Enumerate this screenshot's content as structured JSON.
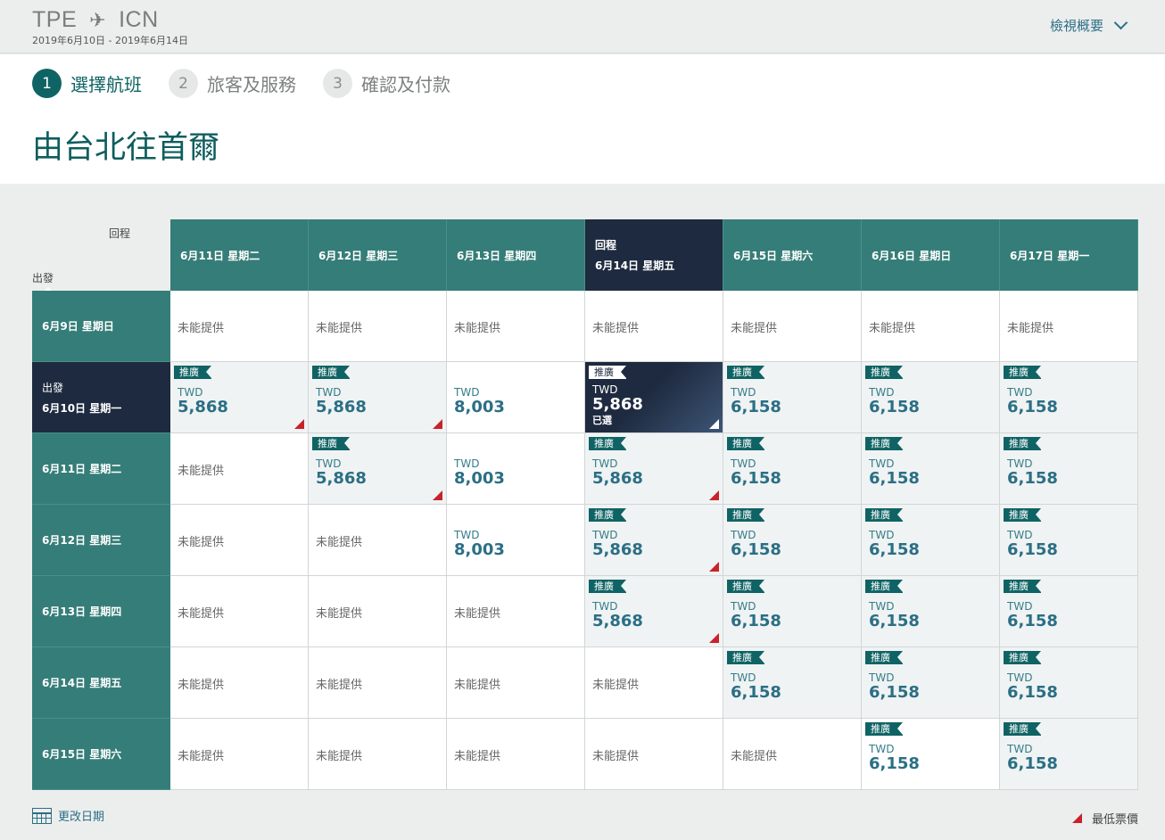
{
  "header": {
    "origin": "TPE",
    "destination": "ICN",
    "dates": "2019年6月10日 - 2019年6月14日",
    "view_summary": "檢視概要"
  },
  "steps": [
    {
      "num": "1",
      "label": "選擇航班",
      "active": true
    },
    {
      "num": "2",
      "label": "旅客及服務",
      "active": false
    },
    {
      "num": "3",
      "label": "確認及付款",
      "active": false
    }
  ],
  "title": "由台北往首爾",
  "grid": {
    "return_label": "回程",
    "depart_label": "出發",
    "columns": [
      {
        "label": "6月11日 星期二",
        "selected": false
      },
      {
        "label": "6月12日 星期三",
        "selected": false
      },
      {
        "label": "6月13日 星期四",
        "selected": false
      },
      {
        "label": "6月14日 星期五",
        "selected": true,
        "tag": "回程"
      },
      {
        "label": "6月15日 星期六",
        "selected": false
      },
      {
        "label": "6月16日 星期日",
        "selected": false
      },
      {
        "label": "6月17日 星期一",
        "selected": false
      }
    ],
    "rows": [
      {
        "label": "6月9日 星期日",
        "selected": false,
        "cells": [
          {
            "na": true
          },
          {
            "na": true
          },
          {
            "na": true
          },
          {
            "na": true
          },
          {
            "na": true
          },
          {
            "na": true
          },
          {
            "na": true
          }
        ]
      },
      {
        "label": "6月10日 星期一",
        "selected": true,
        "tag": "出發",
        "cells": [
          {
            "promo": true,
            "cur": "TWD",
            "price": "5,868",
            "lowest": true
          },
          {
            "promo": true,
            "cur": "TWD",
            "price": "5,868",
            "lowest": true
          },
          {
            "promo": false,
            "cur": "TWD",
            "price": "8,003",
            "lowest": false
          },
          {
            "promo": true,
            "cur": "TWD",
            "price": "5,868",
            "lowest": true,
            "selected": true,
            "chosen": "已選"
          },
          {
            "promo": true,
            "cur": "TWD",
            "price": "6,158",
            "lowest": false
          },
          {
            "promo": true,
            "cur": "TWD",
            "price": "6,158",
            "lowest": false
          },
          {
            "promo": true,
            "cur": "TWD",
            "price": "6,158",
            "lowest": false
          }
        ]
      },
      {
        "label": "6月11日 星期二",
        "selected": false,
        "cells": [
          {
            "na": true
          },
          {
            "promo": true,
            "cur": "TWD",
            "price": "5,868",
            "lowest": true
          },
          {
            "promo": false,
            "cur": "TWD",
            "price": "8,003",
            "lowest": false
          },
          {
            "promo": true,
            "cur": "TWD",
            "price": "5,868",
            "lowest": true
          },
          {
            "promo": true,
            "cur": "TWD",
            "price": "6,158",
            "lowest": false
          },
          {
            "promo": true,
            "cur": "TWD",
            "price": "6,158",
            "lowest": false
          },
          {
            "promo": true,
            "cur": "TWD",
            "price": "6,158",
            "lowest": false
          }
        ]
      },
      {
        "label": "6月12日 星期三",
        "selected": false,
        "cells": [
          {
            "na": true
          },
          {
            "na": true
          },
          {
            "promo": false,
            "cur": "TWD",
            "price": "8,003",
            "lowest": false
          },
          {
            "promo": true,
            "cur": "TWD",
            "price": "5,868",
            "lowest": true
          },
          {
            "promo": true,
            "cur": "TWD",
            "price": "6,158",
            "lowest": false
          },
          {
            "promo": true,
            "cur": "TWD",
            "price": "6,158",
            "lowest": false
          },
          {
            "promo": true,
            "cur": "TWD",
            "price": "6,158",
            "lowest": false
          }
        ]
      },
      {
        "label": "6月13日 星期四",
        "selected": false,
        "cells": [
          {
            "na": true
          },
          {
            "na": true
          },
          {
            "na": true
          },
          {
            "promo": true,
            "cur": "TWD",
            "price": "5,868",
            "lowest": true
          },
          {
            "promo": true,
            "cur": "TWD",
            "price": "6,158",
            "lowest": false
          },
          {
            "promo": true,
            "cur": "TWD",
            "price": "6,158",
            "lowest": false
          },
          {
            "promo": true,
            "cur": "TWD",
            "price": "6,158",
            "lowest": false
          }
        ]
      },
      {
        "label": "6月14日 星期五",
        "selected": false,
        "cells": [
          {
            "na": true
          },
          {
            "na": true
          },
          {
            "na": true
          },
          {
            "na": true
          },
          {
            "promo": true,
            "cur": "TWD",
            "price": "6,158",
            "lowest": false
          },
          {
            "promo": true,
            "cur": "TWD",
            "price": "6,158",
            "lowest": false
          },
          {
            "promo": true,
            "cur": "TWD",
            "price": "6,158",
            "lowest": false
          }
        ]
      },
      {
        "label": "6月15日 星期六",
        "selected": false,
        "cells": [
          {
            "na": true
          },
          {
            "na": true
          },
          {
            "na": true
          },
          {
            "na": true
          },
          {
            "na": true
          },
          {
            "promo": true,
            "cur": "TWD",
            "price": "6,158",
            "lowest": false,
            "plain": true
          },
          {
            "promo": true,
            "cur": "TWD",
            "price": "6,158",
            "lowest": false
          }
        ]
      }
    ],
    "na_text": "未能提供",
    "promo_text": "推廣"
  },
  "footer": {
    "change_dates": "更改日期",
    "legend_lowest": "最低票價"
  },
  "colors": {
    "teal_header": "#357d78",
    "selected_navy": "#1e2a3f",
    "price_blue": "#2b6f85",
    "lowest_red": "#c8222b"
  }
}
